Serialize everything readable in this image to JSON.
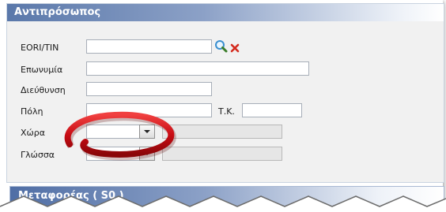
{
  "panel": {
    "title": "Αντιπρόσωπος"
  },
  "form": {
    "eori_label": "EORI/TIN",
    "surname_label": "Επωνυμία",
    "address_label": "Διεύθυνση",
    "city_label": "Πόλη",
    "postal_label": "Τ.Κ.",
    "country_label": "Χώρα",
    "language_label": "Γλώσσα"
  },
  "panel2": {
    "title": "Μεταφορέας ( S0 )"
  },
  "icons": {
    "search": "search-icon",
    "clear": "close-icon",
    "dropdown": "chevron-down-icon"
  },
  "colors": {
    "header_start": "#5a78aa",
    "annotation_red": "#d0101a",
    "clear_red": "#d42b1e"
  }
}
